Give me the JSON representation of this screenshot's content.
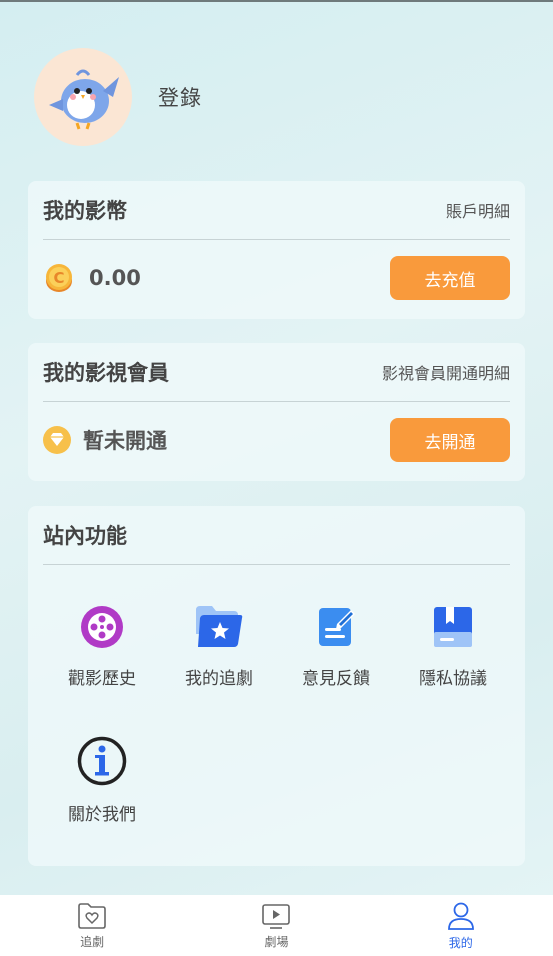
{
  "profile": {
    "login_label": "登錄"
  },
  "coins": {
    "title": "我的影幣",
    "detail_link": "賬戶明細",
    "balance": "0.00",
    "recharge_label": "去充值"
  },
  "vip": {
    "title": "我的影視會員",
    "detail_link": "影視會員開通明細",
    "status": "暫未開通",
    "open_label": "去開通"
  },
  "features": {
    "title": "站內功能",
    "items": [
      {
        "label": "觀影歷史",
        "icon": "film-reel-icon"
      },
      {
        "label": "我的追劇",
        "icon": "star-folder-icon"
      },
      {
        "label": "意見反饋",
        "icon": "feedback-edit-icon"
      },
      {
        "label": "隱私協議",
        "icon": "privacy-book-icon"
      },
      {
        "label": "關於我們",
        "icon": "info-icon"
      }
    ]
  },
  "tabbar": {
    "items": [
      {
        "label": "追劇",
        "icon": "heart-folder-icon"
      },
      {
        "label": "劇場",
        "icon": "tv-play-icon"
      },
      {
        "label": "我的",
        "icon": "user-icon"
      }
    ],
    "active_color": "#2c67e8"
  },
  "colors": {
    "accent_button": "#f99a3c"
  }
}
